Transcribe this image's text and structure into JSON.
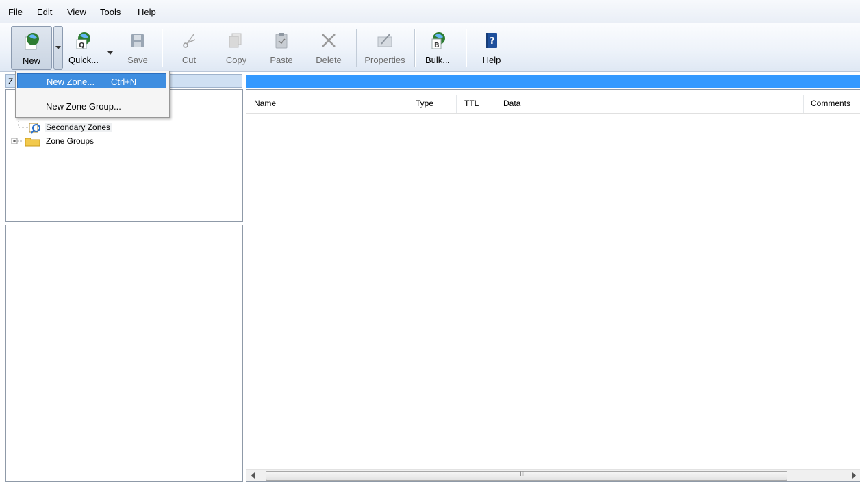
{
  "menu": [
    "File",
    "Edit",
    "View",
    "Tools",
    "Help"
  ],
  "toolbar": {
    "new": "New",
    "quick": "Quick...",
    "save": "Save",
    "cut": "Cut",
    "copy": "Copy",
    "paste": "Paste",
    "delete": "Delete",
    "properties": "Properties",
    "bulk": "Bulk...",
    "help": "Help"
  },
  "zone_header": "Z",
  "tree": {
    "items": [
      {
        "label": "Secondary Zones",
        "icon": "secondary-zone-icon"
      },
      {
        "label": "Zone Groups",
        "icon": "folder-icon"
      }
    ]
  },
  "dropdown": {
    "items": [
      {
        "label": "New Zone...",
        "shortcut": "Ctrl+N"
      },
      {
        "label": "New Zone Group...",
        "shortcut": ""
      }
    ]
  },
  "list": {
    "columns": [
      "Name",
      "Type",
      "TTL",
      "Data",
      "Comments"
    ]
  },
  "scroll": {
    "grip": "III"
  },
  "colors": {
    "selection": "#3399ff",
    "menu_highlight": "#3f8ee0"
  }
}
